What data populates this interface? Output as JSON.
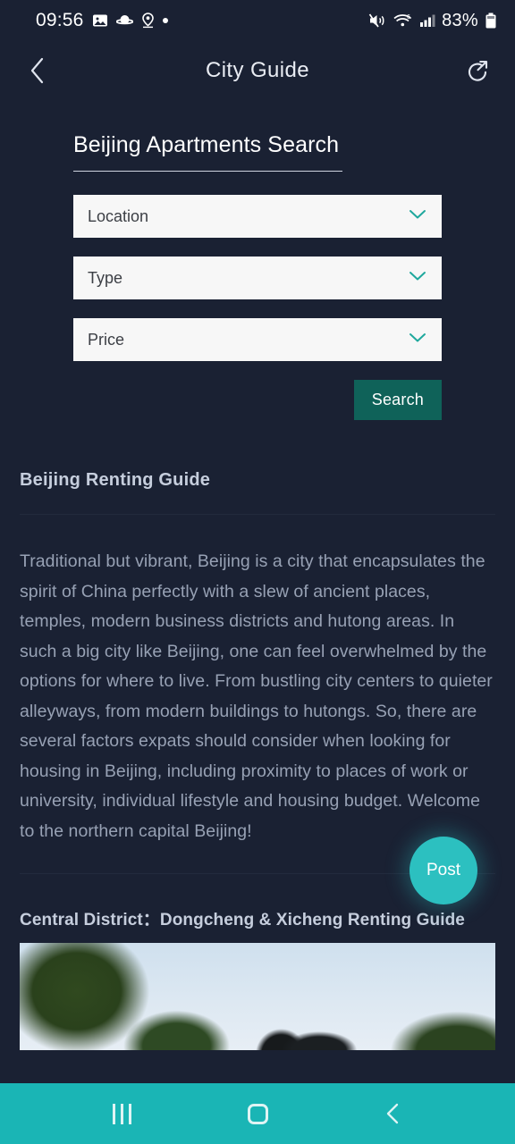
{
  "status_bar": {
    "time": "09:56",
    "battery_percent": "83%",
    "left_icons": [
      "image-icon",
      "planet-icon",
      "location-pin-icon",
      "dot-icon"
    ],
    "right_icons": [
      "mute-icon",
      "wifi-icon",
      "cellular-signal-icon",
      "battery-icon"
    ]
  },
  "app_bar": {
    "title": "City Guide",
    "back_icon": "back-chevron-icon",
    "share_icon": "share-icon"
  },
  "search_panel": {
    "title": "Beijing Apartments Search",
    "fields": [
      {
        "label": "Location",
        "name": "location"
      },
      {
        "label": "Type",
        "name": "type"
      },
      {
        "label": "Price",
        "name": "price"
      }
    ],
    "search_label": "Search"
  },
  "guide": {
    "heading": "Beijing Renting Guide",
    "body": "Traditional but vibrant, Beijing is a city that encapsulates the spirit of China perfectly with a slew of ancient places, temples, modern business districts and hutong areas. In such a big city like Beijing, one can feel overwhelmed by the options for where to live. From bustling city centers to quieter alleyways, from modern buildings to hutongs. So, there are several factors expats should consider when looking for housing in Beijing, including proximity to places of work or university, individual lifestyle and housing budget. Welcome to the northern capital Beijing!",
    "section_heading": "Central District：Dongcheng & Xicheng Renting Guide"
  },
  "fab": {
    "label": "Post"
  },
  "nav_bar": {
    "recents_label": "recents-icon",
    "home_label": "home-icon",
    "back_label": "back-icon"
  },
  "colors": {
    "background": "#1a2133",
    "accent_teal": "#1ab5b5",
    "fab_teal": "#2cc0c0",
    "search_button": "#0f6259",
    "field_bg": "#f7f7f7",
    "body_text": "#97a1b4"
  }
}
